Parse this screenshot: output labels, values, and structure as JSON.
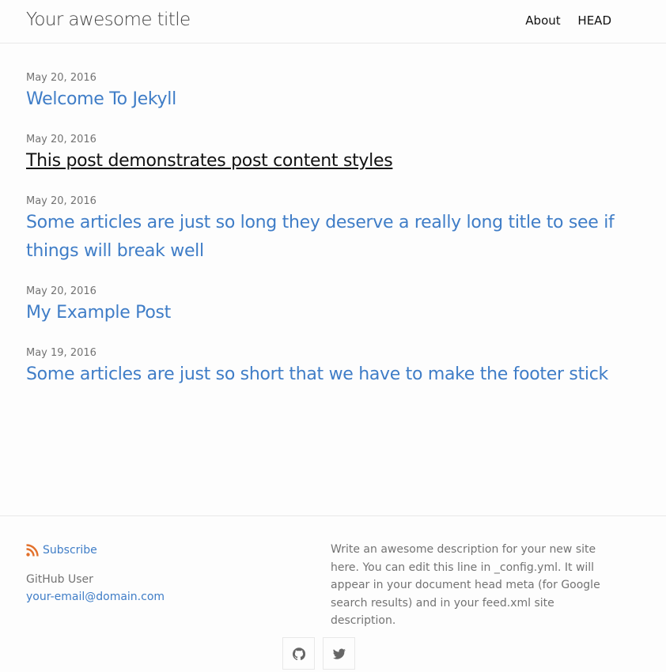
{
  "header": {
    "site_title": "Your awesome title",
    "nav": [
      {
        "label": "About"
      },
      {
        "label": "HEAD"
      }
    ]
  },
  "posts": [
    {
      "date": "May 20, 2016",
      "title": "Welcome To Jekyll",
      "hovered": false
    },
    {
      "date": "May 20, 2016",
      "title": "This post demonstrates post content styles",
      "hovered": true
    },
    {
      "date": "May 20, 2016",
      "title": "Some articles are just so long they deserve a really long title to see if things will break well",
      "hovered": false
    },
    {
      "date": "May 20, 2016",
      "title": "My Example Post",
      "hovered": false
    },
    {
      "date": "May 19, 2016",
      "title": "Some articles are just so short that we have to make the footer stick",
      "hovered": false
    }
  ],
  "footer": {
    "subscribe_label": "Subscribe",
    "author": "GitHub User",
    "email": "your-email@domain.com",
    "description": "Write an awesome description for your new site here. You can edit this line in _config.yml. It will appear in your document head meta (for Google search results) and in your feed.xml site description.",
    "social": [
      {
        "icon": "github-icon"
      },
      {
        "icon": "twitter-icon"
      }
    ]
  },
  "colors": {
    "link": "#3f7dc7",
    "meta": "#737373",
    "rss": "#e2712c",
    "border": "#e8e8e8"
  }
}
